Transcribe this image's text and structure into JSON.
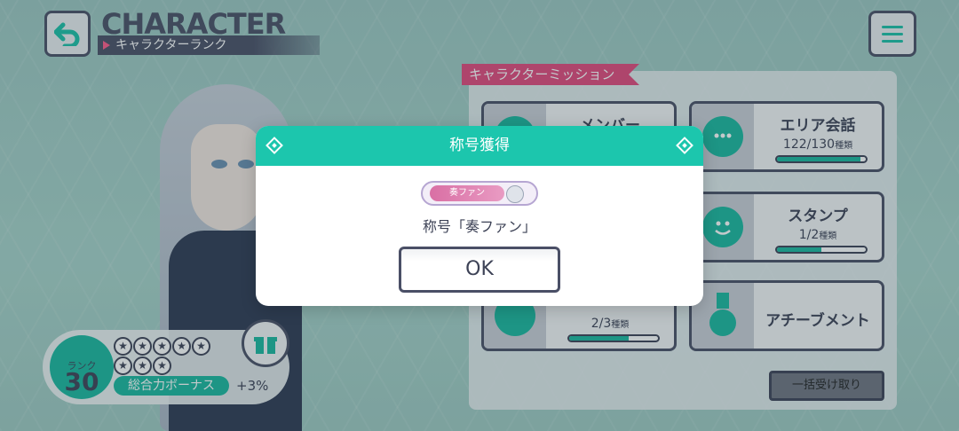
{
  "header": {
    "title": "CHARACTER",
    "subtitle": "キャラクターランク"
  },
  "mission": {
    "label": "キャラクターミッション",
    "cards": [
      {
        "title": "メンバー",
        "count": "",
        "unit": "",
        "progress": 0.0
      },
      {
        "title": "エリア会話",
        "count": "122/130",
        "unit": "種類",
        "progress": 0.94
      },
      {
        "title": "スタンプ",
        "count": "1/2",
        "unit": "種類",
        "progress": 0.5
      },
      {
        "title": "",
        "count": "2/3",
        "unit": "種類",
        "progress": 0.67
      },
      {
        "title": "アチーブメント",
        "count": "",
        "unit": "",
        "progress": 0.0
      }
    ],
    "claim_all_label": "一括受け取り"
  },
  "rank": {
    "label": "ランク",
    "value": "30",
    "bonus_label": "総合力ボーナス",
    "bonus_value": "+3%",
    "stars_total": 8
  },
  "dialog": {
    "title": "称号獲得",
    "badge_text": "奏ファン",
    "message": "称号「奏ファン」",
    "ok_label": "OK"
  },
  "colors": {
    "accent": "#1cc6ad",
    "dark": "#4a4f66",
    "mission_label": "#e2487c"
  }
}
